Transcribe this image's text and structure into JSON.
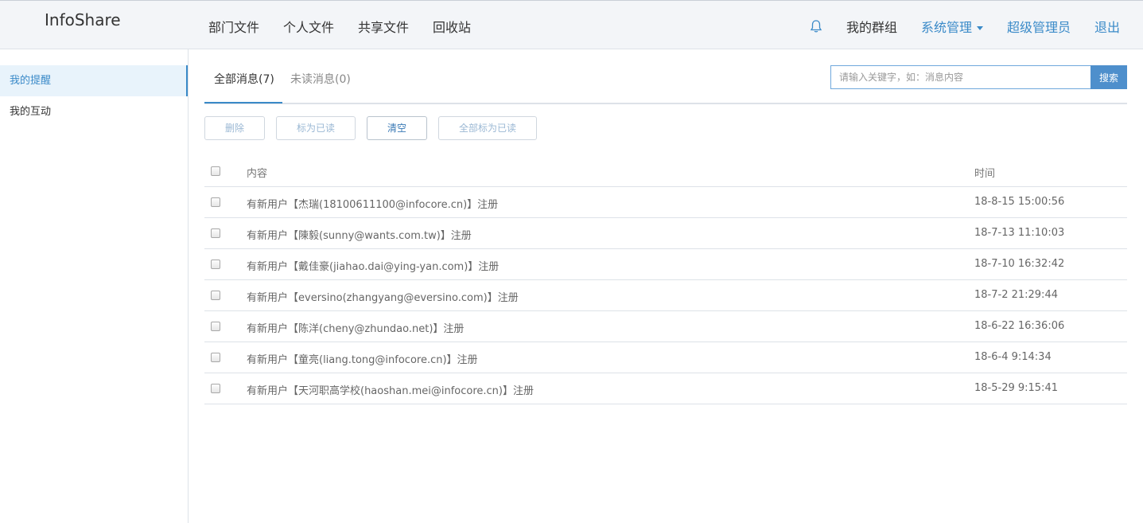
{
  "navbar": {
    "brand": "InfoShare",
    "left_links": [
      "部门文件",
      "个人文件",
      "共享文件",
      "回收站"
    ],
    "my_groups": "我的群组",
    "system_admin": "系统管理",
    "super_admin": "超级管理员",
    "logout": "退出"
  },
  "sidebar": {
    "items": [
      {
        "label": "我的提醒",
        "active": true
      },
      {
        "label": "我的互动",
        "active": false
      }
    ]
  },
  "tabs": {
    "all": "全部消息(7)",
    "unread": "未读消息(0)"
  },
  "search": {
    "placeholder": "请输入关键字，如：消息内容",
    "button": "搜索"
  },
  "toolbar": {
    "delete": "删除",
    "mark_read": "标为已读",
    "clear": "清空",
    "mark_all_read": "全部标为已读"
  },
  "table": {
    "headers": {
      "content": "内容",
      "time": "时间"
    },
    "rows": [
      {
        "content": "有新用户【杰瑞(18100611100@infocore.cn)】注册",
        "time": "18-8-15 15:00:56"
      },
      {
        "content": "有新用户【陳毅(sunny@wants.com.tw)】注册",
        "time": "18-7-13 11:10:03"
      },
      {
        "content": "有新用户【戴佳豪(jiahao.dai@ying-yan.com)】注册",
        "time": "18-7-10 16:32:42"
      },
      {
        "content": "有新用户【eversino(zhangyang@eversino.com)】注册",
        "time": "18-7-2 21:29:44"
      },
      {
        "content": "有新用户【陈洋(cheny@zhundao.net)】注册",
        "time": "18-6-22 16:36:06"
      },
      {
        "content": "有新用户【童亮(liang.tong@infocore.cn)】注册",
        "time": "18-6-4 9:14:34"
      },
      {
        "content": "有新用户【天河职高学校(haoshan.mei@infocore.cn)】注册",
        "time": "18-5-29 9:15:41"
      }
    ]
  }
}
